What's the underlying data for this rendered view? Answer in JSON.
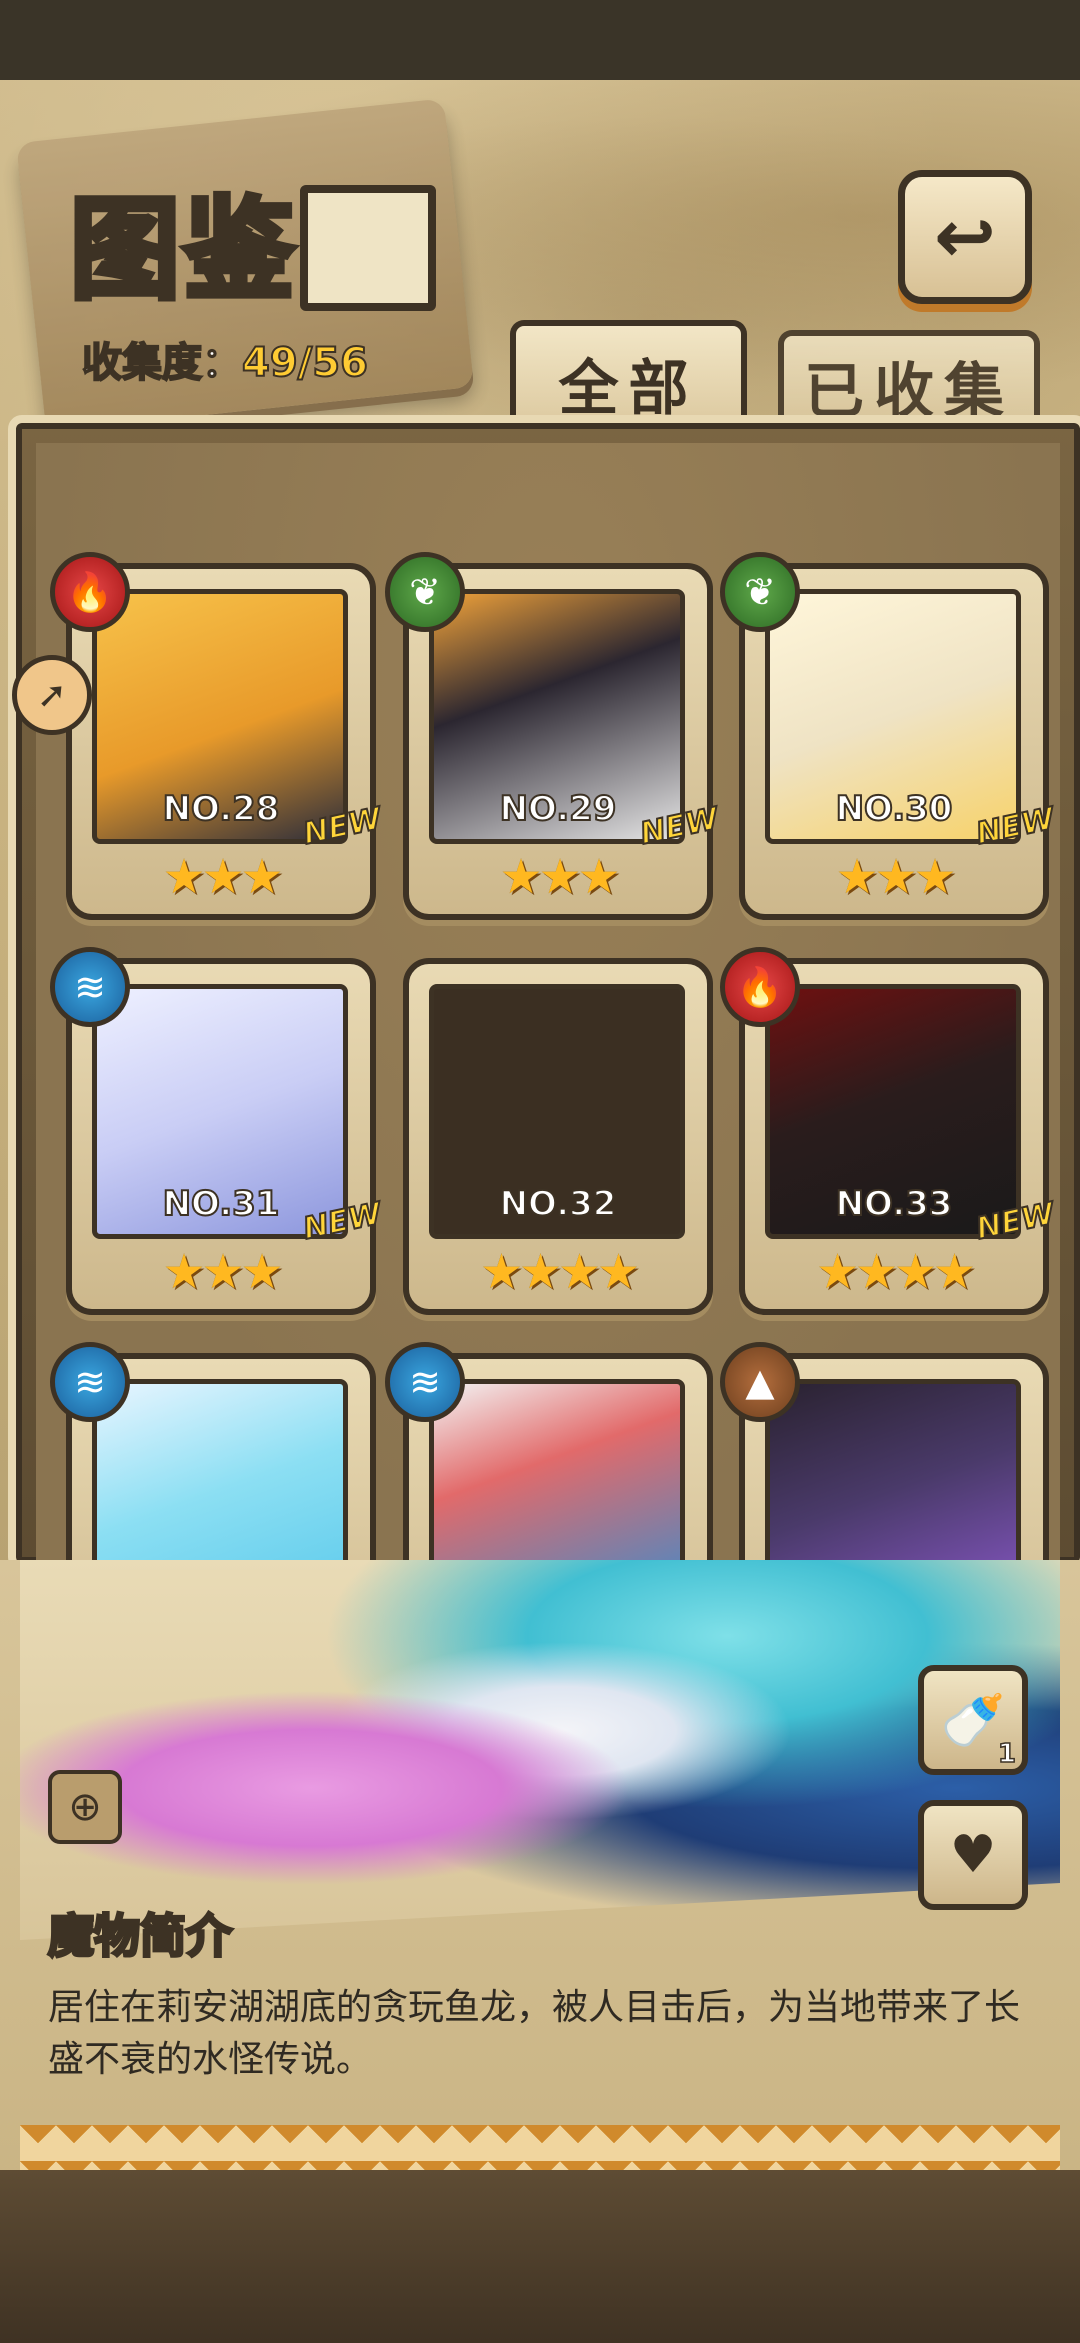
{
  "header": {
    "title": "图鉴",
    "progress_label": "收集度：",
    "progress_value": "49/56",
    "back_icon": "back-arrow-icon"
  },
  "tabs": [
    {
      "label": "全部",
      "active": true
    },
    {
      "label": "已收集",
      "active": false
    }
  ],
  "cards": [
    {
      "no": "NO.28",
      "element": "fire",
      "stars": "★★★",
      "new": "NEW",
      "colors": [
        "#f7c24a",
        "#2e2e3a"
      ]
    },
    {
      "no": "NO.29",
      "element": "leaf",
      "stars": "★★★",
      "new": "NEW",
      "colors": [
        "#2b2630",
        "#f0a23a"
      ]
    },
    {
      "no": "NO.30",
      "element": "leaf",
      "stars": "★★★",
      "new": "NEW",
      "colors": [
        "#efe3c4",
        "#f7d26a"
      ]
    },
    {
      "no": "NO.31",
      "element": "water",
      "stars": "★★★",
      "new": "NEW",
      "colors": [
        "#dfe2fb",
        "#9aa6e6"
      ]
    },
    {
      "no": "NO.32",
      "element": "none",
      "stars": "★★★★",
      "new": "",
      "colors": [
        "#3b2f22",
        "#3b2f22"
      ]
    },
    {
      "no": "NO.33",
      "element": "fire",
      "stars": "★★★★",
      "new": "NEW",
      "colors": [
        "#2a1c1c",
        "#b42222"
      ]
    },
    {
      "no": "",
      "element": "water",
      "stars": "",
      "new": "",
      "colors": [
        "#e8f5ff",
        "#55c7ea"
      ]
    },
    {
      "no": "",
      "element": "water",
      "stars": "",
      "new": "",
      "colors": [
        "#f3f3f3",
        "#2c8fd6"
      ]
    },
    {
      "no": "",
      "element": "earth",
      "stars": "",
      "new": "",
      "colors": [
        "#2a2230",
        "#8e5bd0"
      ]
    }
  ],
  "detail": {
    "section_title": "魔物简介",
    "description": "居住在莉安湖湖底的贪玩鱼龙，被人目击后，为当地带来了长盛不衰的水怪传说。",
    "item_count": "1"
  }
}
